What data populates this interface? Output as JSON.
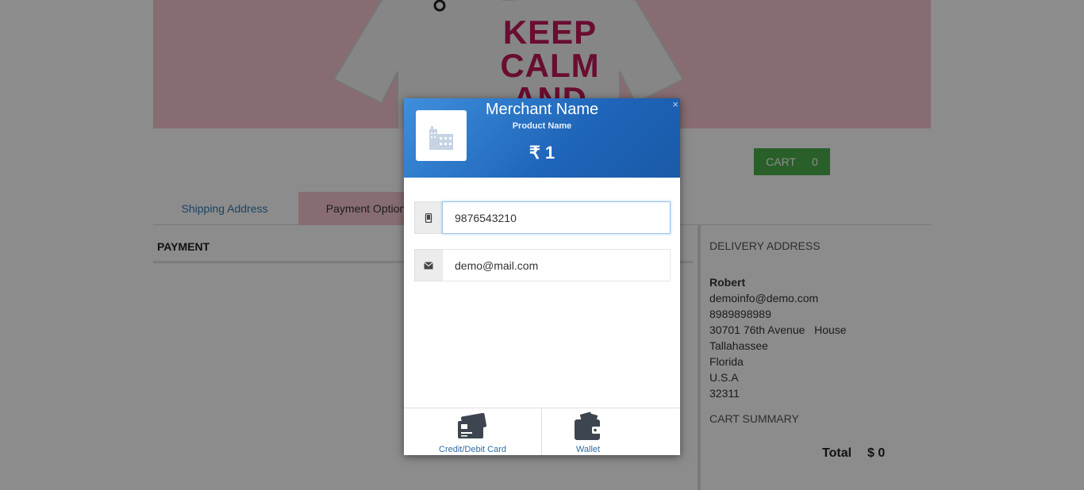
{
  "banner": {
    "shirt_text": [
      "KEEP",
      "CALM",
      "AND"
    ]
  },
  "cart": {
    "label": "CART",
    "count": "0"
  },
  "tabs": [
    {
      "label": "Shipping Address"
    },
    {
      "label": "Payment Option"
    }
  ],
  "payment": {
    "title": "PAYMENT"
  },
  "delivery": {
    "heading": "DELIVERY ADDRESS",
    "name": "Robert",
    "email": "demoinfo@demo.com",
    "phone": "8989898989",
    "street": "30701 76th Avenue   House",
    "city": "Tallahassee",
    "state": "Florida",
    "country": "U.S.A",
    "zip": "32311"
  },
  "cart_summary": {
    "heading": "CART SUMMARY",
    "total_label": "Total",
    "total_value": "$ 0"
  },
  "modal": {
    "merchant_name": "Merchant Name",
    "product_name": "Product Name",
    "amount": "₹ 1",
    "close": "×",
    "phone_value": "9876543210",
    "email_value": "demo@mail.com",
    "options": [
      {
        "label": "Credit/Debit Card",
        "icon": "credit-card-icon"
      },
      {
        "label": "Wallet",
        "icon": "wallet-icon"
      }
    ]
  },
  "colors": {
    "banner_pink": "#f6c7d0",
    "cart_green": "#4cae4c",
    "header_blue": "#1e64b8",
    "link_blue": "#337ab7"
  }
}
